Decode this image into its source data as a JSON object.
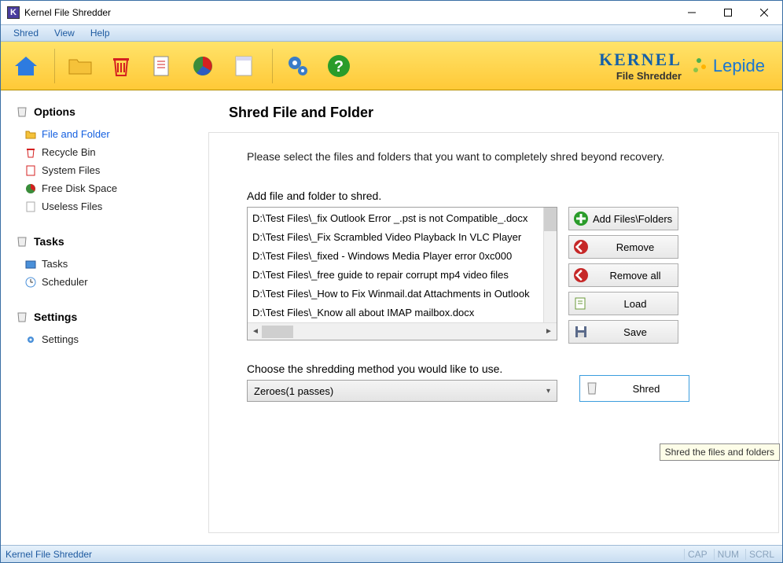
{
  "window": {
    "title": "Kernel File Shredder"
  },
  "menu": {
    "shred": "Shred",
    "view": "View",
    "help": "Help"
  },
  "toolbar_brand": {
    "name": "KERNEL",
    "sub": "File Shredder",
    "vendor": "Lepide"
  },
  "sidebar": {
    "options_title": "Options",
    "options": [
      {
        "label": "File and Folder",
        "active": true
      },
      {
        "label": "Recycle Bin"
      },
      {
        "label": "System Files"
      },
      {
        "label": "Free Disk Space"
      },
      {
        "label": "Useless Files"
      }
    ],
    "tasks_title": "Tasks",
    "tasks": [
      {
        "label": "Tasks"
      },
      {
        "label": "Scheduler"
      }
    ],
    "settings_title": "Settings",
    "settings": [
      {
        "label": "Settings"
      }
    ]
  },
  "main": {
    "heading": "Shred File and Folder",
    "intro": "Please select the files and folders that you want to completely shred beyond recovery.",
    "list_label": "Add file and folder to shred.",
    "files": [
      "D:\\Test Files\\_fix Outlook Error _.pst is not Compatible_.docx",
      "D:\\Test Files\\_Fix Scrambled Video Playback In VLC Player",
      "D:\\Test Files\\_fixed - Windows Media Player error 0xc000",
      "D:\\Test Files\\_free guide to repair corrupt mp4 video files",
      "D:\\Test Files\\_How to Fix Winmail.dat Attachments in Outlook",
      "D:\\Test Files\\_Know all about IMAP mailbox.docx"
    ],
    "buttons": {
      "add": "Add Files\\Folders",
      "remove": "Remove",
      "remove_all": "Remove all",
      "load": "Load",
      "save": "Save",
      "shred": "Shred"
    },
    "method_label": "Choose the shredding method you would like to use.",
    "method_value": "Zeroes(1 passes)",
    "tooltip": "Shred the files and folders"
  },
  "status": {
    "text": "Kernel File Shredder",
    "cap": "CAP",
    "num": "NUM",
    "scrl": "SCRL"
  }
}
